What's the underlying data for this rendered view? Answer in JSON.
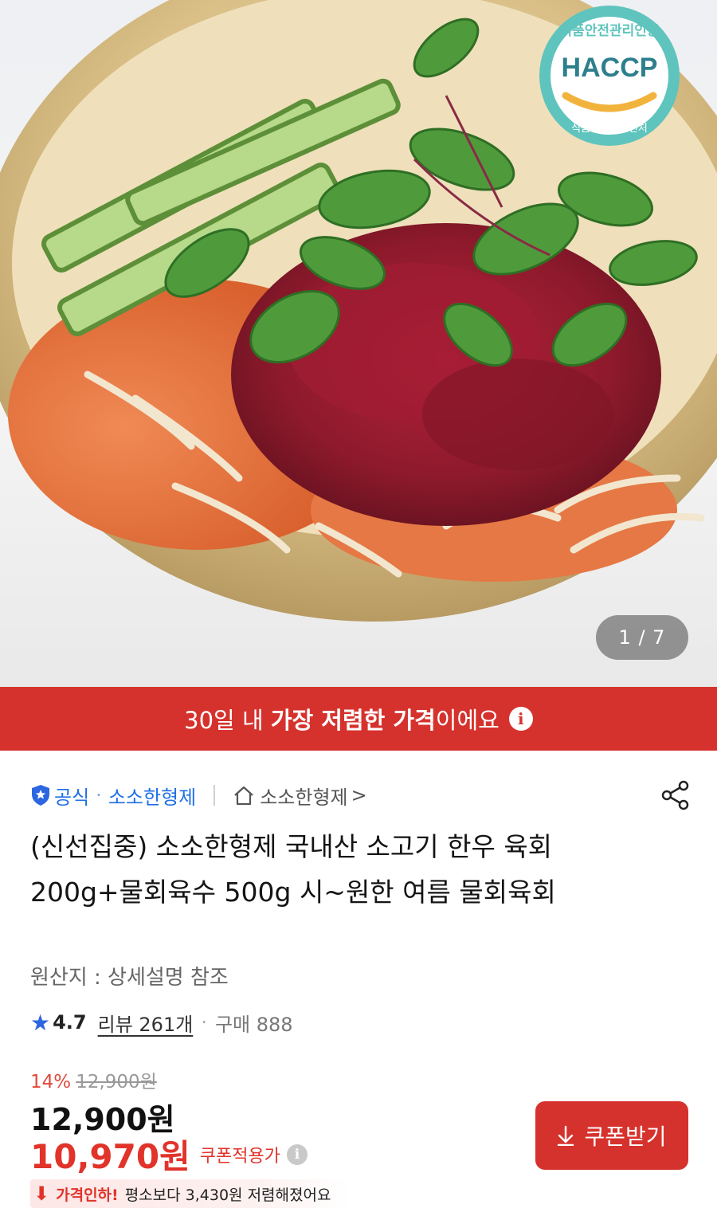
{
  "hero": {
    "slide_counter": "1 / 7",
    "badge": {
      "top_text": "식품안전관리인증",
      "main_text": "HACCP",
      "bottom_text": "식품의약품안전처"
    }
  },
  "banner": {
    "text_prefix": "30일 내 ",
    "text_strong": "가장 저렴한 가격",
    "text_suffix": "이에요",
    "info_icon": "i"
  },
  "store": {
    "official_label": "공식",
    "dot": "·",
    "store_name": "소소한형제",
    "home_store_name": "소소한형제",
    "chevron": ">"
  },
  "product": {
    "title": "(신선집중) 소소한형제 국내산 소고기 한우 육회 200g+물회육수 500g 시~원한 여름 물회육회",
    "origin": "원산지 : 상세설명 참조"
  },
  "rating": {
    "score": "4.7",
    "reviews": "리뷰 261개",
    "sep": "·",
    "purchase": "구매 888"
  },
  "price": {
    "discount_pct": "14%",
    "original": "12,900원",
    "sale": "12,900원",
    "coupon_price": "10,970원",
    "coupon_label": "쿠폰적용가",
    "drop_strong": "가격인하!",
    "drop_text": "평소보다 3,430원 저렴해졌어요"
  },
  "coupon_button": {
    "label": "쿠폰받기"
  },
  "colors": {
    "brand_red": "#d6322d",
    "link_blue": "#1f6fe5",
    "badge_teal": "#5fc4bd"
  }
}
